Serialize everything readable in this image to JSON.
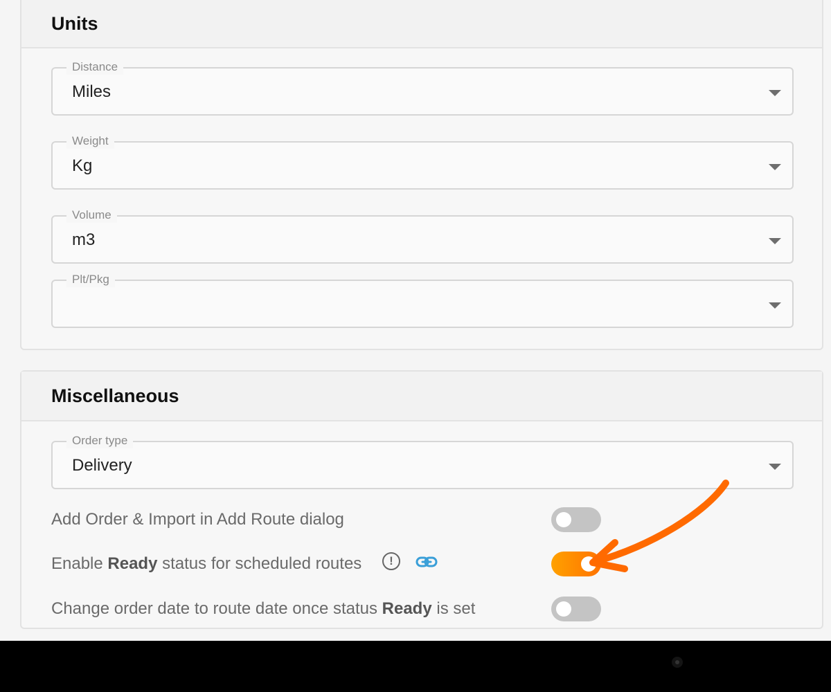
{
  "units": {
    "title": "Units",
    "fields": [
      {
        "label": "Distance",
        "value": "Miles"
      },
      {
        "label": "Weight",
        "value": "Kg"
      },
      {
        "label": "Volume",
        "value": "m3"
      },
      {
        "label": "Plt/Pkg",
        "value": ""
      }
    ]
  },
  "misc": {
    "title": "Miscellaneous",
    "order_type": {
      "label": "Order type",
      "value": "Delivery"
    },
    "settings": [
      {
        "parts": [
          "Add Order & Import in Add Route dialog"
        ],
        "enabled": false
      },
      {
        "parts": [
          "Enable ",
          "Ready",
          " status for scheduled routes"
        ],
        "enabled": true
      },
      {
        "parts": [
          "Change order date to route date once status ",
          "Ready",
          " is set"
        ],
        "enabled": false
      }
    ],
    "info_icon_glyph": "!"
  },
  "colors": {
    "toggle_on": "#ff8a00",
    "toggle_off": "#c4c4c4",
    "annotation": "#ff6a00",
    "link_icon": "#3a9fd8"
  },
  "icons": [
    "dropdown-arrow-icon",
    "info-icon",
    "link-icon",
    "annotation-arrow"
  ]
}
